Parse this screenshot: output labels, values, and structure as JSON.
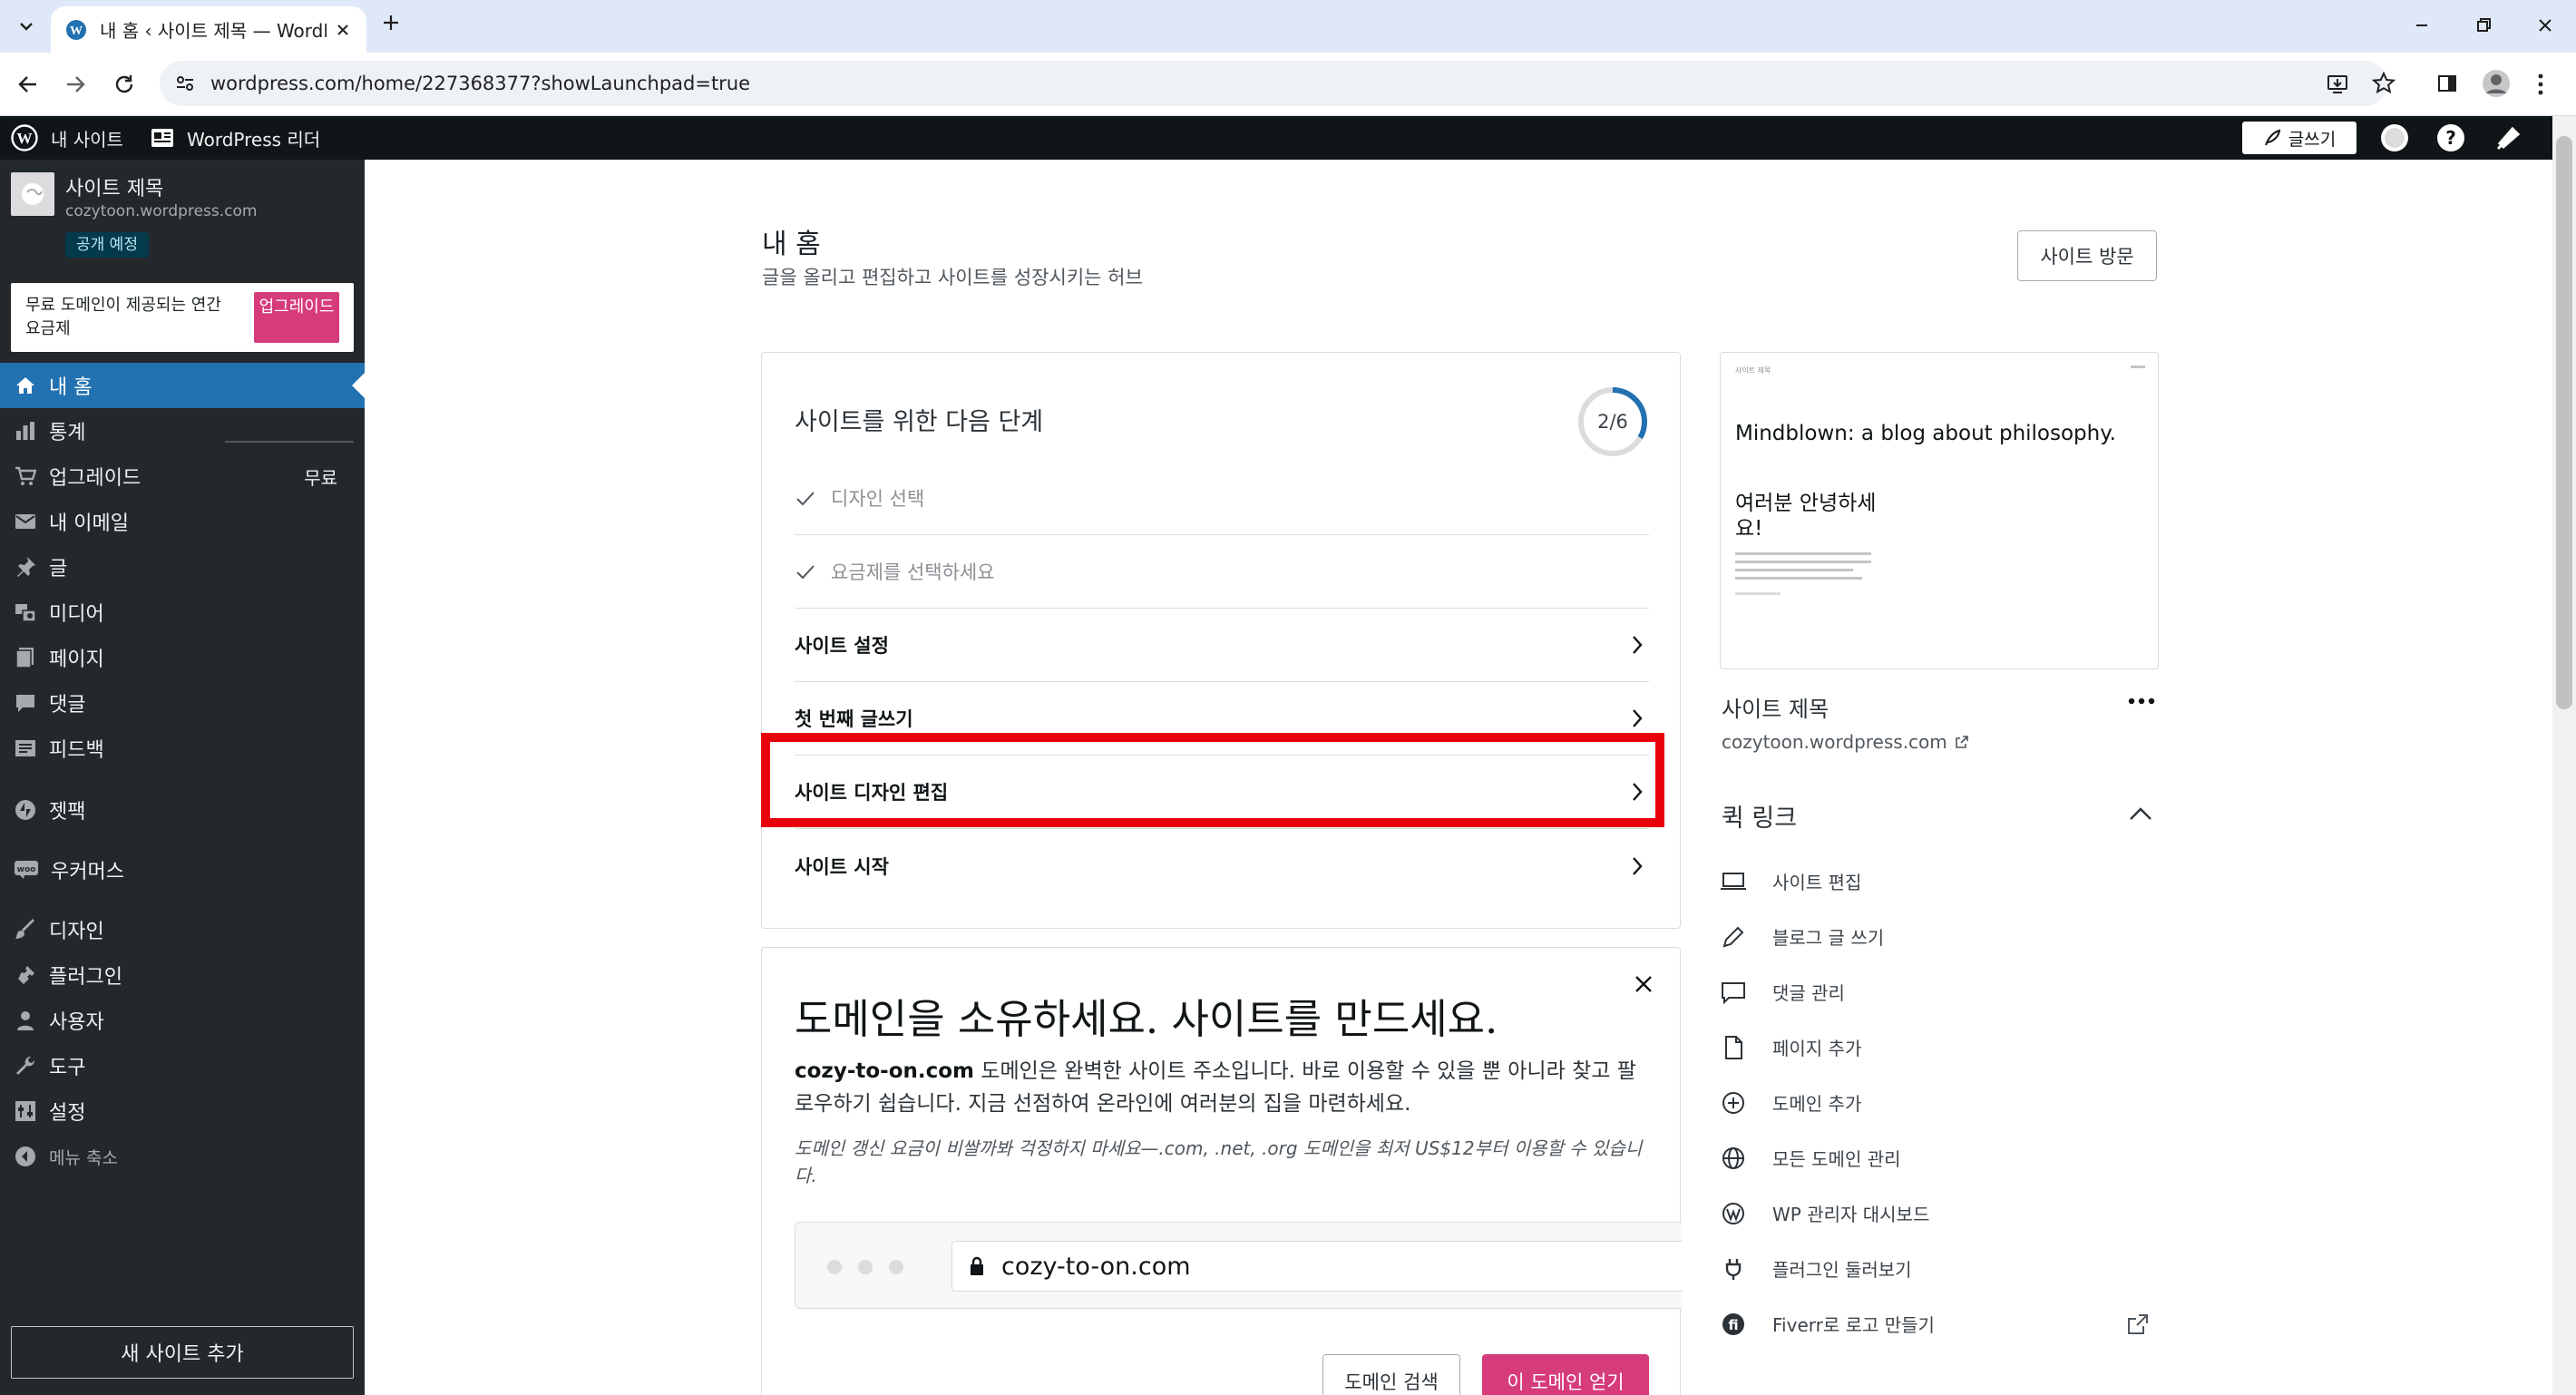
{
  "browser": {
    "tab_title": "내 홈 ‹ 사이트 제목 — WordPress.com",
    "url": "wordpress.com/home/227368377?showLaunchpad=true"
  },
  "adminbar": {
    "my_site": "내 사이트",
    "reader": "WordPress 리더",
    "write": "글쓰기"
  },
  "site": {
    "title": "사이트 제목",
    "domain": "cozytoon.wordpress.com",
    "badge": "공개 예정"
  },
  "upsell": {
    "text": "무료 도메인이 제공되는 연간 요금제",
    "button": "업그레이드"
  },
  "nav": [
    {
      "label": "내 홈",
      "icon": "home-icon"
    },
    {
      "label": "통계",
      "icon": "stats-icon"
    },
    {
      "label": "업그레이드",
      "icon": "cart-icon",
      "badge": "무료"
    },
    {
      "label": "내 이메일",
      "icon": "mail-icon"
    },
    {
      "label": "글",
      "icon": "pin-icon"
    },
    {
      "label": "미디어",
      "icon": "media-icon"
    },
    {
      "label": "페이지",
      "icon": "page-icon"
    },
    {
      "label": "댓글",
      "icon": "comment-icon"
    },
    {
      "label": "피드백",
      "icon": "feedback-icon"
    },
    {
      "label": "젯팩",
      "icon": "jetpack-icon"
    },
    {
      "label": "우커머스",
      "icon": "woo-icon"
    },
    {
      "label": "디자인",
      "icon": "brush-icon"
    },
    {
      "label": "플러그인",
      "icon": "plugin-icon"
    },
    {
      "label": "사용자",
      "icon": "user-icon"
    },
    {
      "label": "도구",
      "icon": "wrench-icon"
    },
    {
      "label": "설정",
      "icon": "settings-icon"
    },
    {
      "label": "메뉴 축소",
      "icon": "collapse-icon"
    }
  ],
  "sidebar_footer": {
    "add_site": "새 사이트 추가"
  },
  "header": {
    "title": "내 홈",
    "subtitle": "글을 올리고 편집하고 사이트를 성장시키는 허브",
    "visit_button": "사이트 방문"
  },
  "launchpad": {
    "title": "사이트를 위한 다음 단계",
    "progress_label": "2/6",
    "progress": 0.333,
    "tasks": [
      {
        "label": "디자인 선택",
        "done": true
      },
      {
        "label": "요금제를 선택하세요",
        "done": true
      },
      {
        "label": "사이트 설정",
        "done": false
      },
      {
        "label": "첫 번째 글쓰기",
        "done": false
      },
      {
        "label": "사이트 디자인 편집",
        "done": false,
        "highlighted": true
      },
      {
        "label": "사이트 시작",
        "done": false
      }
    ]
  },
  "domain_card": {
    "title": "도메인을 소유하세요. 사이트를 만드세요.",
    "domain": "cozy-to-on.com",
    "body_rest": " 도메인은 완벽한 사이트 주소입니다. 바로 이용할 수 있을 뿐 아니라 찾고 팔로우하기 쉽습니다. 지금 선점하여 온라인에 여러분의 집을 마련하세요.",
    "note": "도메인 갱신 요금이 비쌀까봐 걱정하지 마세요—.com, .net, .org 도메인을 최저 US$12부터 이용할 수 있습니다.",
    "url_preview": "cozy-to-on.com",
    "search_button": "도메인 검색",
    "get_button": "이 도메인 얻기"
  },
  "preview": {
    "tiny_title": "사이트 제목",
    "headline": "Mindblown: a blog about philosophy.",
    "greeting": "여러분 안녕하세요!",
    "site_title": "사이트 제목",
    "site_url": "cozytoon.wordpress.com"
  },
  "quick_links": {
    "title": "퀵 링크",
    "items": [
      {
        "label": "사이트 편집",
        "icon": "laptop-icon"
      },
      {
        "label": "블로그 글 쓰기",
        "icon": "pencil-icon"
      },
      {
        "label": "댓글 관리",
        "icon": "comment-icon"
      },
      {
        "label": "페이지 추가",
        "icon": "page-icon"
      },
      {
        "label": "도메인 추가",
        "icon": "plus-circle-icon"
      },
      {
        "label": "모든 도메인 관리",
        "icon": "globe-icon"
      },
      {
        "label": "WP 관리자 대시보드",
        "icon": "wordpress-icon"
      },
      {
        "label": "플러그인 둘러보기",
        "icon": "plug-icon"
      },
      {
        "label": "Fiverr로 로고 만들기",
        "icon": "fiverr-icon"
      }
    ]
  },
  "colors": {
    "accent": "#2271b1",
    "pink": "#d63b7b",
    "highlight": "#e8000b",
    "admin": "#101517",
    "sidebar": "#23282d"
  }
}
